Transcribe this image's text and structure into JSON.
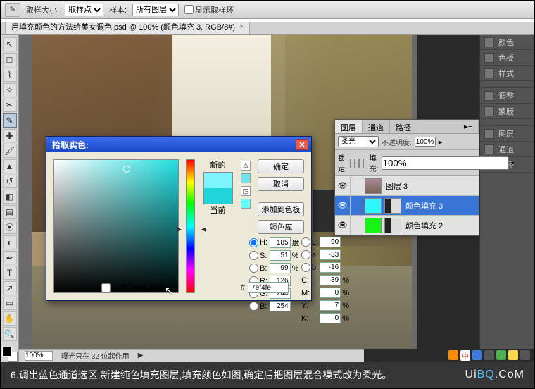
{
  "options_bar": {
    "sample_size_label": "取样大小:",
    "sample_size_value": "取样点",
    "sample_label": "样本:",
    "sample_value": "所有图层",
    "show_ring_label": "显示取样环"
  },
  "document_tab": "用填充颜色的方法给美女调色.psd @ 100% (颜色填充 3, RGB/8#)",
  "status": {
    "zoom": "100%",
    "note": "曝光只在 32 位起作用"
  },
  "right_narrow": {
    "items": [
      "颜色",
      "色板",
      "样式"
    ],
    "items2": [
      "调整",
      "蒙版"
    ],
    "items3": [
      "图层",
      "通道",
      "路径"
    ]
  },
  "layers_panel": {
    "tabs": {
      "layers": "图层",
      "channels": "通道",
      "paths": "路径"
    },
    "blend_mode": "柔光",
    "opacity_label": "不透明度:",
    "opacity_value": "100%",
    "lock_label": "锁定:",
    "fill_label": "填充:",
    "fill_value": "100%",
    "rows": [
      {
        "name": "图层 3",
        "thumb": "photo"
      },
      {
        "name": "颜色填充 3",
        "thumb": "cyan",
        "selected": true
      },
      {
        "name": "颜色填充 2",
        "thumb": "green"
      }
    ]
  },
  "color_picker": {
    "title": "拾取实色:",
    "new_label": "新的",
    "current_label": "当前",
    "buttons": {
      "ok": "确定",
      "cancel": "取消",
      "add": "添加到色板",
      "lib": "颜色库"
    },
    "hsb": {
      "h": "185",
      "s": "51",
      "b": "99"
    },
    "lab": {
      "l": "90",
      "a": "-33",
      "b2": "-16"
    },
    "rgb": {
      "r": "126",
      "g": "244",
      "b": "254"
    },
    "cmyk": {
      "c": "39",
      "m": "0",
      "y": "7",
      "k": "0"
    },
    "hex": "7ef4fe",
    "units": {
      "deg": "度",
      "pct": "%"
    },
    "web_only_label": "只有 Web 颜色",
    "new_color": "#7ef4fe",
    "cur_color": "#20d4da"
  },
  "caption": "6.调出蓝色通道选区,新建纯色填充图层,填充颜色如图,确定后把图层混合模式改为柔光。",
  "watermark": {
    "ui": "Ui",
    "bq": "BQ",
    "com": ".CoM"
  },
  "sys_tray": {
    "lang": "中"
  }
}
